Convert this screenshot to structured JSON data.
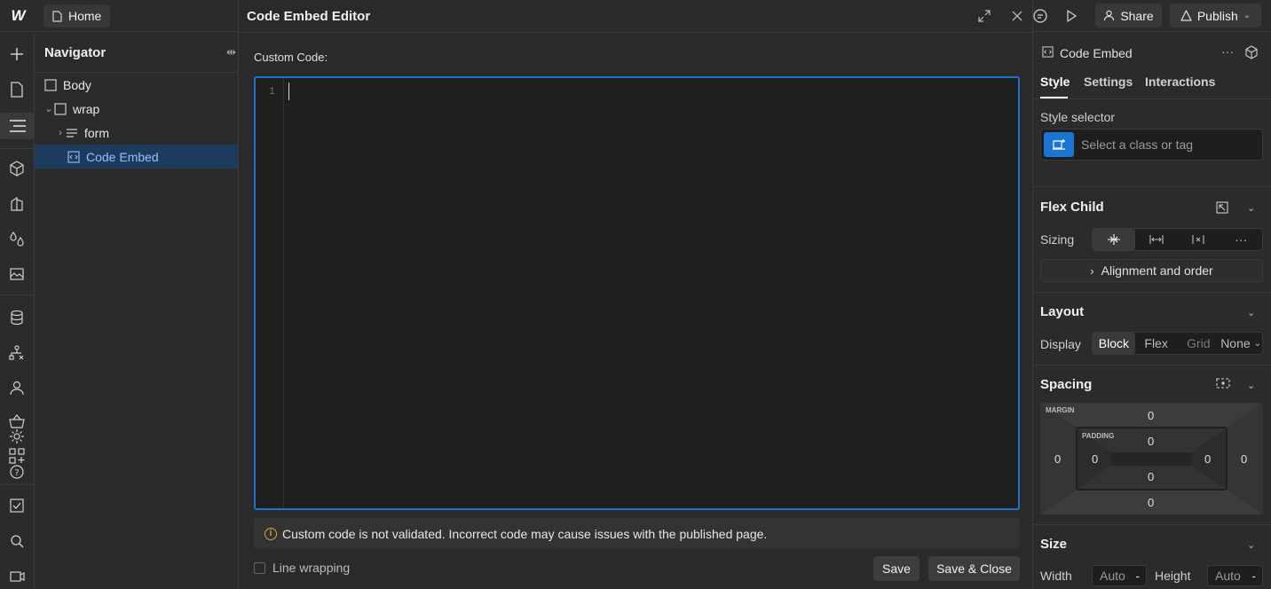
{
  "topbar": {
    "logo": "W",
    "home_label": "Home",
    "share_label": "Share",
    "publish_label": "Publish"
  },
  "navigator": {
    "title": "Navigator",
    "close": "⇹",
    "items": [
      {
        "label": "Body"
      },
      {
        "label": "wrap"
      },
      {
        "label": "form"
      },
      {
        "label": "Code Embed"
      }
    ]
  },
  "modal": {
    "title": "Code Embed Editor",
    "custom_code_label": "Custom Code:",
    "line_number": "1",
    "code_value": "",
    "warning": "Custom code is not validated. Incorrect code may cause issues with the published page.",
    "line_wrapping_label": "Line wrapping",
    "save_label": "Save",
    "save_close_label": "Save & Close"
  },
  "right_panel": {
    "element_name": "Code Embed",
    "more": "···",
    "tabs": [
      "Style",
      "Settings",
      "Interactions"
    ],
    "style_selector_label": "Style selector",
    "style_selector_placeholder": "Select a class or tag",
    "flex_child": {
      "title": "Flex Child",
      "sizing_label": "Sizing",
      "sizing_more": "···",
      "alignment_label": "Alignment and order"
    },
    "layout": {
      "title": "Layout",
      "display_label": "Display",
      "options": [
        "Block",
        "Flex",
        "Grid",
        "None"
      ],
      "selected": "Block"
    },
    "spacing": {
      "title": "Spacing",
      "margin_label": "MARGIN",
      "padding_label": "PADDING",
      "margin_top": "0",
      "margin_right": "0",
      "margin_bottom": "0",
      "margin_left": "0",
      "padding_top": "0",
      "padding_right": "0",
      "padding_bottom": "0",
      "padding_left": "0"
    },
    "size": {
      "title": "Size",
      "width_label": "Width",
      "width_value": "Auto",
      "height_label": "Height",
      "height_value": "Auto",
      "unit": "-"
    }
  },
  "colors": {
    "accent": "#1a74d2",
    "selected_row_bg": "#1d3b5c",
    "selected_row_text": "#8ec3ff",
    "warning_icon": "#d9a23a"
  }
}
